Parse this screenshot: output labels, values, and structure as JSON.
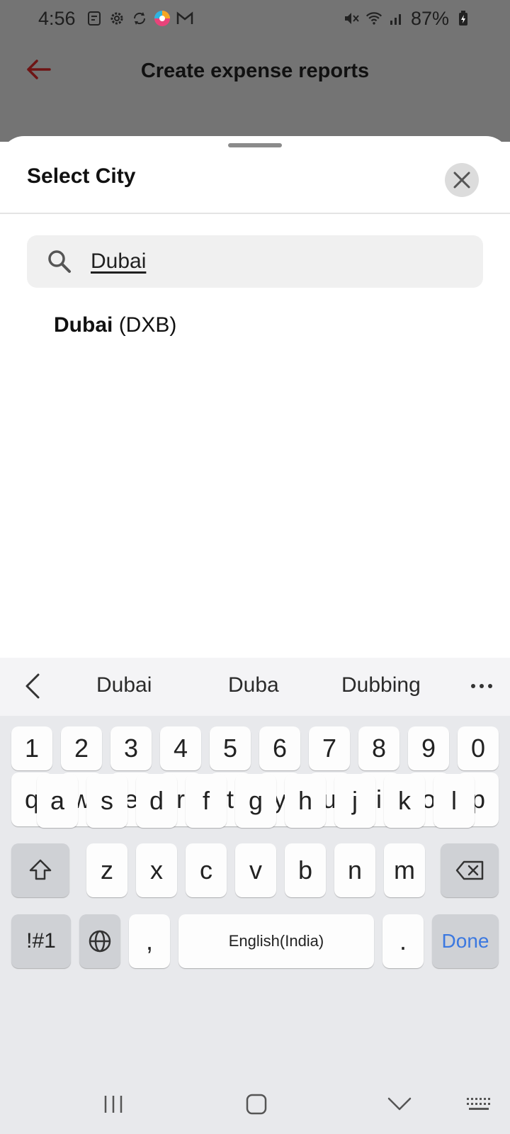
{
  "status_bar": {
    "time": "4:56",
    "battery": "87%",
    "icons_left": [
      "document-icon",
      "settings-icon",
      "sync-icon",
      "browser-icon",
      "gmail-icon"
    ],
    "icons_right": [
      "mute-icon",
      "wifi-icon",
      "signal-icon",
      "battery-icon"
    ]
  },
  "header": {
    "title": "Create expense reports",
    "back_icon": "arrow-left-icon",
    "accent": "#7a1a1a"
  },
  "sheet": {
    "title": "Select City",
    "close_icon": "close-icon",
    "search": {
      "value": "Dubai",
      "icon": "search-icon"
    },
    "results": [
      {
        "city": "Dubai",
        "code": "(DXB)"
      }
    ]
  },
  "keyboard": {
    "suggestions": [
      "Dubai",
      "Duba",
      "Dubbing"
    ],
    "row_numbers": [
      "1",
      "2",
      "3",
      "4",
      "5",
      "6",
      "7",
      "8",
      "9",
      "0"
    ],
    "row1": [
      "q",
      "w",
      "e",
      "r",
      "t",
      "y",
      "u",
      "i",
      "o",
      "p"
    ],
    "row2": [
      "a",
      "s",
      "d",
      "f",
      "g",
      "h",
      "j",
      "k",
      "l"
    ],
    "row3": [
      "z",
      "x",
      "c",
      "v",
      "b",
      "n",
      "m"
    ],
    "symbols_label": "!#1",
    "comma": ",",
    "space_label": "English(India)",
    "period": ".",
    "done_label": "Done",
    "done_color": "#3b78e0"
  }
}
